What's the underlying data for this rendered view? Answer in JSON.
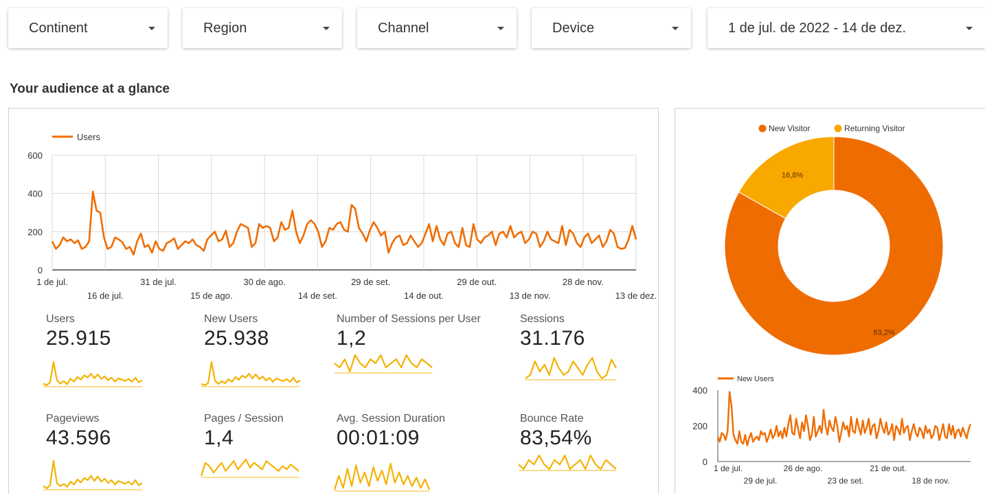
{
  "filters": [
    {
      "label": "Continent"
    },
    {
      "label": "Region"
    },
    {
      "label": "Channel"
    },
    {
      "label": "Device"
    },
    {
      "label": "1 de jul. de 2022 - 14 de dez."
    }
  ],
  "section_title": "Your audience at a glance",
  "colors": {
    "primary": "#ef6c00",
    "secondary": "#f9a800",
    "spark": "#f3b200",
    "grid": "#d9d9d9"
  },
  "metrics": [
    {
      "label": "Users",
      "value": "25.915"
    },
    {
      "label": "New Users",
      "value": "25.938"
    },
    {
      "label": "Number of Sessions per User",
      "value": "1,2"
    },
    {
      "label": "Sessions",
      "value": "31.176"
    },
    {
      "label": "Pageviews",
      "value": "43.596"
    },
    {
      "label": "Pages / Session",
      "value": "1,4"
    },
    {
      "label": "Avg. Session Duration",
      "value": "00:01:09"
    },
    {
      "label": "Bounce Rate",
      "value": "83,54%"
    }
  ],
  "chart_data": [
    {
      "type": "line",
      "legend": "Users",
      "ylim": [
        0,
        600
      ],
      "y_ticks": [
        "0",
        "200",
        "400",
        "600"
      ],
      "x_ticks": [
        "1 de jul.",
        "16 de jul.",
        "31 de jul.",
        "15 de ago.",
        "30 de ago.",
        "14 de set.",
        "29 de set.",
        "14 de out.",
        "29 de out.",
        "13 de nov.",
        "28 de nov.",
        "13 de dez."
      ],
      "grid": true,
      "values": [
        150,
        110,
        130,
        170,
        150,
        160,
        140,
        155,
        110,
        120,
        150,
        410,
        310,
        300,
        170,
        110,
        120,
        170,
        160,
        145,
        110,
        120,
        80,
        150,
        190,
        120,
        130,
        90,
        150,
        110,
        100,
        140,
        150,
        165,
        110,
        130,
        150,
        140,
        160,
        130,
        120,
        100,
        160,
        180,
        200,
        150,
        160,
        205,
        120,
        140,
        200,
        240,
        230,
        220,
        120,
        140,
        240,
        220,
        230,
        220,
        150,
        170,
        250,
        210,
        220,
        310,
        200,
        140,
        180,
        240,
        260,
        240,
        200,
        120,
        150,
        220,
        210,
        240,
        250,
        210,
        200,
        340,
        320,
        220,
        190,
        150,
        210,
        250,
        220,
        180,
        200,
        90,
        140,
        170,
        180,
        130,
        140,
        180,
        150,
        120,
        140,
        190,
        240,
        150,
        230,
        160,
        130,
        190,
        200,
        140,
        120,
        220,
        130,
        120,
        240,
        160,
        140,
        170,
        180,
        200,
        130,
        190,
        200,
        170,
        230,
        170,
        190,
        200,
        140,
        160,
        200,
        190,
        120,
        150,
        200,
        160,
        150,
        140,
        230,
        130,
        210,
        190,
        140,
        120,
        170,
        190,
        140,
        160,
        180,
        120,
        150,
        210,
        190,
        120,
        110,
        115,
        160,
        230,
        160
      ],
      "marks_per_axis": "daily"
    },
    {
      "type": "pie",
      "legend": [
        "New Visitor",
        "Returning Visitor"
      ],
      "slices": [
        {
          "name": "New Visitor",
          "value": 83.2,
          "label": "83,2%"
        },
        {
          "name": "Returning Visitor",
          "value": 16.8,
          "label": "16,8%"
        }
      ]
    },
    {
      "type": "line",
      "legend": "New Users",
      "ylim": [
        0,
        400
      ],
      "y_ticks": [
        "0",
        "200",
        "400"
      ],
      "x_ticks": [
        "1 de jul.",
        "29 de jul.",
        "26 de ago.",
        "23 de set.",
        "21 de out.",
        "18 de nov."
      ],
      "grid": false,
      "values": [
        140,
        110,
        160,
        150,
        120,
        170,
        390,
        310,
        150,
        120,
        100,
        170,
        110,
        100,
        150,
        90,
        130,
        160,
        110,
        130,
        140,
        120,
        170,
        150,
        160,
        110,
        140,
        180,
        130,
        150,
        200,
        140,
        170,
        130,
        190,
        140,
        210,
        260,
        160,
        150,
        240,
        180,
        130,
        220,
        170,
        260,
        200,
        120,
        150,
        250,
        140,
        170,
        200,
        160,
        290,
        200,
        150,
        230,
        190,
        170,
        250,
        200,
        110,
        160,
        220,
        180,
        200,
        140,
        250,
        170,
        160,
        240,
        190,
        150,
        230,
        160,
        190,
        240,
        150,
        200,
        210,
        130,
        170,
        240,
        190,
        160,
        220,
        150,
        170,
        210,
        120,
        200,
        180,
        150,
        240,
        160,
        190,
        200,
        120,
        170,
        210,
        160,
        140,
        190,
        170,
        130,
        200,
        160,
        180,
        130,
        150,
        200,
        190,
        120,
        160,
        210,
        140,
        130,
        210,
        150,
        200,
        130,
        170,
        180,
        140,
        190,
        160,
        130,
        180,
        210
      ]
    }
  ],
  "sparklines": {
    "users": [
      30,
      25,
      34,
      95,
      40,
      30,
      38,
      28,
      45,
      36,
      50,
      42,
      55,
      48,
      60,
      46,
      58,
      44,
      52,
      40,
      48,
      36,
      46,
      42,
      38,
      44,
      36,
      48,
      34,
      40
    ],
    "new_users": [
      28,
      24,
      30,
      92,
      38,
      28,
      36,
      30,
      42,
      34,
      48,
      40,
      52,
      46,
      58,
      44,
      56,
      42,
      50,
      38,
      46,
      34,
      44,
      40,
      36,
      42,
      34,
      46,
      32,
      38
    ],
    "sessions_per_user": [
      40,
      38,
      42,
      36,
      44,
      40,
      38,
      42,
      40,
      44,
      38,
      40,
      42,
      38,
      44,
      40,
      38,
      42,
      40,
      38
    ],
    "sessions": [
      30,
      40,
      80,
      50,
      70,
      40,
      90,
      60,
      40,
      50,
      80,
      60,
      40,
      70,
      90,
      50,
      30,
      40,
      85,
      60
    ],
    "pageviews": [
      28,
      22,
      30,
      96,
      36,
      28,
      34,
      26,
      40,
      32,
      46,
      38,
      50,
      44,
      56,
      42,
      54,
      40,
      48,
      36,
      44,
      32,
      42,
      38,
      34,
      40,
      32,
      44,
      30,
      36
    ],
    "pages_per_session": [
      30,
      70,
      60,
      40,
      55,
      70,
      45,
      60,
      75,
      50,
      65,
      80,
      55,
      70,
      60,
      50,
      75,
      65,
      55,
      45,
      60,
      50,
      65,
      55,
      45
    ],
    "avg_session_duration": [
      20,
      60,
      25,
      80,
      30,
      90,
      40,
      70,
      30,
      85,
      45,
      75,
      35,
      95,
      40,
      70,
      35,
      60,
      30,
      55,
      25,
      50,
      20
    ],
    "bounce_rate": [
      40,
      38,
      42,
      40,
      44,
      40,
      38,
      42,
      40,
      44,
      38,
      40,
      42,
      38,
      44,
      40,
      38,
      42,
      40,
      38
    ]
  }
}
